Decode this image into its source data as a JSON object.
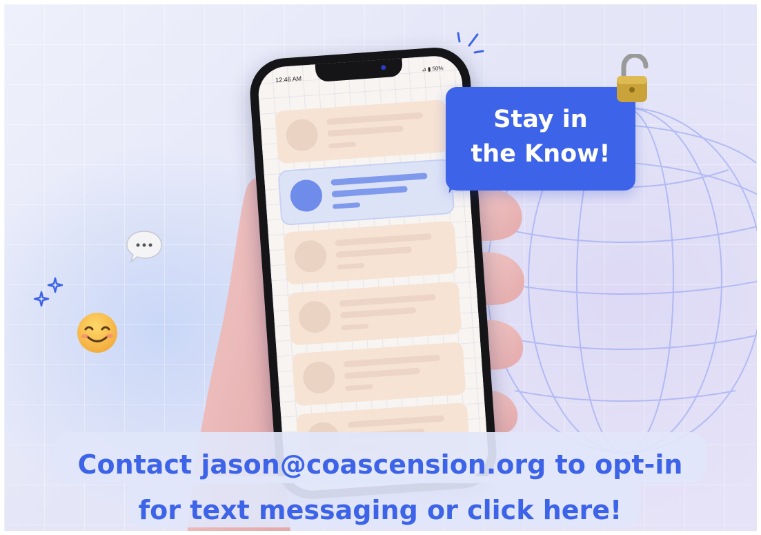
{
  "phone": {
    "status_time": "12:46 AM",
    "status_right": "⊿ ▮ 50%"
  },
  "bubble": {
    "text": "Stay in\nthe Know!",
    "color": "#3d63e8"
  },
  "cta": {
    "text": "Contact jason@coascension.org to opt-in\nfor text messaging or click here!",
    "color": "#3d63e8"
  },
  "icons": [
    "lock-icon",
    "speech-bubble-icon",
    "sparkles-icon",
    "smiley-icon",
    "spark-lines-icon"
  ]
}
